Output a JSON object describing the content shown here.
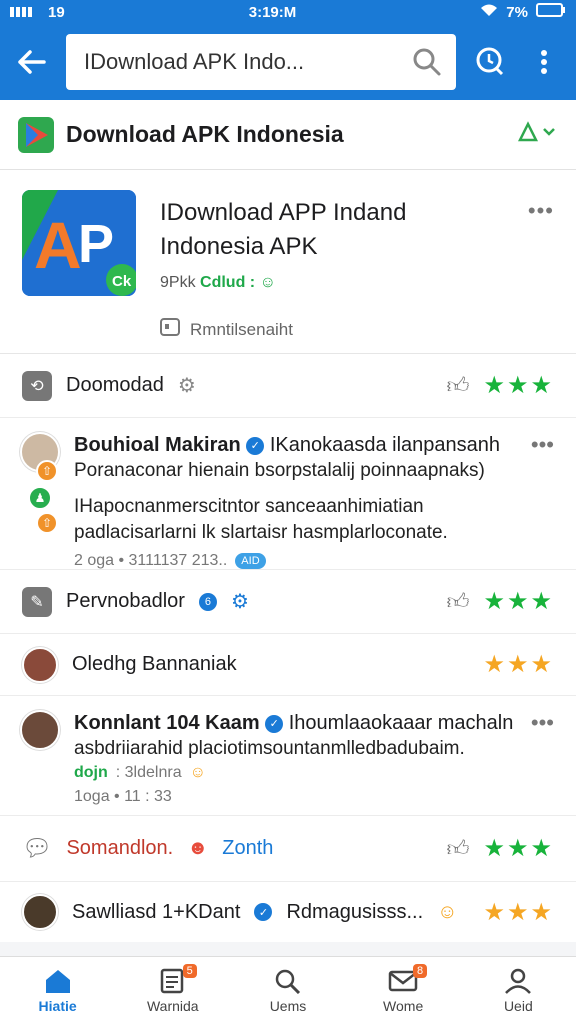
{
  "status_bar": {
    "left": "19",
    "time": "3:19:M",
    "battery": "7%"
  },
  "search": {
    "value": "IDownload APK Indo..."
  },
  "section": {
    "title": "Download APK Indonesia"
  },
  "app": {
    "name_line1": "IDownload APP Indand",
    "name_line2": "Indonesia APK",
    "meta_prefix": "9Pkk",
    "meta_green": "Cdlud :",
    "permission": "Rmntilsenaiht"
  },
  "rows": [
    {
      "type": "simple",
      "label": "Doomodad",
      "stars": "★★★",
      "star_color": "green"
    },
    {
      "type": "review",
      "author": "Bouhioal Makiran",
      "headline": "IKanokaasda ilanpansanh",
      "line2": "Poranaconar hienain bsorpstalalij poinnaapnaks)",
      "line3": "IHapocnanmerscitntor sanceaanhimiatian",
      "line4": "padlacisarlarni lk slartaisr hasmplarloconate.",
      "sub": "2 oga • 3111137 213..",
      "pill": "AID"
    },
    {
      "type": "simple",
      "label": "Pervnobadlor",
      "stars": "★★★",
      "star_color": "green"
    },
    {
      "type": "simple-avatar",
      "label": "Oledhg Bannaniak",
      "stars": "★★★",
      "star_color": "gold"
    },
    {
      "type": "review",
      "author": "Konnlant 104 Kaam",
      "headline": "Ihoumlaaokaaar machaln",
      "line2": "asbdriiarahid placiotimsountanmlledbadubaim.",
      "sub_green": "dojn",
      "sub_green_rest": ": 3ldelnra",
      "sub": "1oga • 11 : 33"
    },
    {
      "type": "simple",
      "label": "Somandlon.",
      "label_extra": "Zonth",
      "stars": "★★★",
      "star_color": "green"
    },
    {
      "type": "simple-avatar",
      "label": "Sawlliasd 1+KDant",
      "label_extra": "Rdmagusisss...",
      "stars": "★★★",
      "star_color": "gold"
    }
  ],
  "nav": [
    {
      "label": "Hiatie"
    },
    {
      "label": "Warnida",
      "badge": "5"
    },
    {
      "label": "Uems"
    },
    {
      "label": "Wome",
      "badge": "8"
    },
    {
      "label": "Ueid"
    }
  ]
}
